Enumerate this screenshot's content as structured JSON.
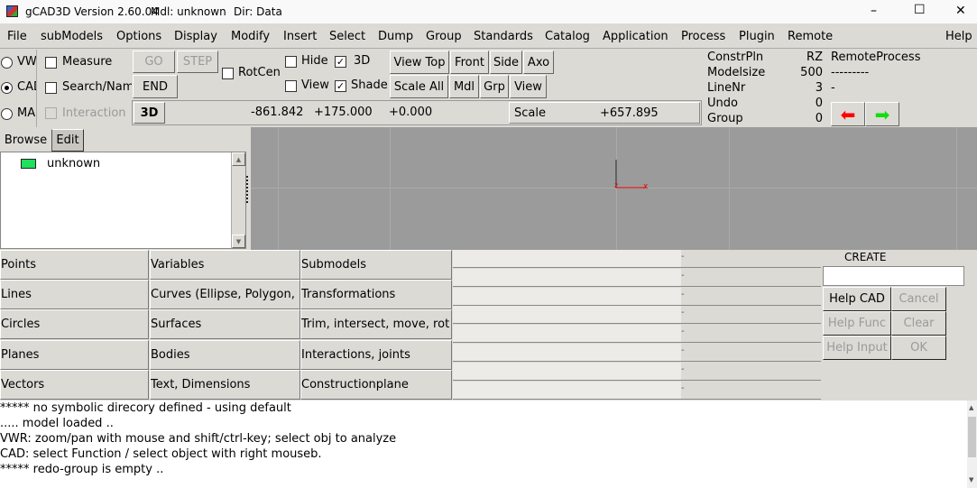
{
  "title": {
    "app": "gCAD3D Version 2.60.04",
    "model": "Mdl: unknown",
    "dir": "Dir: Data",
    "minimize": "–",
    "maximize": "☐",
    "close": "✕"
  },
  "menu": [
    "File",
    "subModels",
    "Options",
    "Display",
    "Modify",
    "Insert",
    "Select",
    "Dump",
    "Group",
    "Standards",
    "Catalog",
    "Application",
    "Process",
    "Plugin",
    "Remote",
    "Help"
  ],
  "modes": {
    "vwr": "VWR",
    "cad": "CAD",
    "man": "MAN",
    "selected": "CAD"
  },
  "checks": {
    "measure": "Measure",
    "search": "Search/Name",
    "interaction": "Interaction",
    "rotcen": "RotCen",
    "hide": "Hide",
    "d3": "3D",
    "view": "View",
    "shade": "Shade"
  },
  "buttons": {
    "go": "GO",
    "step": "STEP",
    "end": "END",
    "view_top": "View Top",
    "front": "Front",
    "side": "Side",
    "axo": "Axo",
    "scale_all": "Scale All",
    "mdl": "Mdl",
    "grp": "Grp",
    "view": "View"
  },
  "coords": {
    "mode": "3D",
    "x": "-861.842",
    "y": "+175.000",
    "z": "+0.000",
    "scale_label": "Scale",
    "scale": "+657.895"
  },
  "status": {
    "constrpln_label": "ConstrPln",
    "constrpln": "RZ",
    "modelsize_label": "Modelsize",
    "modelsize": "500",
    "linenr_label": "LineNr",
    "linenr": "3",
    "undo_label": "Undo",
    "undo": "0",
    "group_label": "Group",
    "group": "0",
    "remote": "RemoteProcess",
    "remote_sep": "---------",
    "remote_val": "-"
  },
  "browser": {
    "tabs": [
      "Browse",
      "Edit"
    ],
    "items": [
      "unknown"
    ]
  },
  "functions": [
    [
      "Points",
      "Variables",
      "Submodels"
    ],
    [
      "Lines",
      "Curves (Ellipse, Polygon,",
      "Transformations"
    ],
    [
      "Circles",
      "Surfaces",
      "Trim, intersect, move, rot"
    ],
    [
      "Planes",
      "Bodies",
      "Interactions, joints"
    ],
    [
      "Vectors",
      "Text, Dimensions",
      "Constructionplane"
    ]
  ],
  "inputs": [
    "-",
    "-",
    "-",
    "-",
    "-",
    "-",
    "-",
    "-"
  ],
  "create": {
    "title": "CREATE",
    "value": "",
    "help_cad": "Help CAD",
    "cancel": "Cancel",
    "help_func": "Help Func",
    "clear": "Clear",
    "help_input": "Help Input",
    "ok": "OK"
  },
  "messages": [
    "***** no symbolic direcory defined - using default",
    "..... model  loaded ..",
    "VWR: zoom/pan with mouse and shift/ctrl-key; select obj to analyze",
    "CAD: select Function / select object with right mouseb.",
    "***** redo-group is empty .."
  ]
}
